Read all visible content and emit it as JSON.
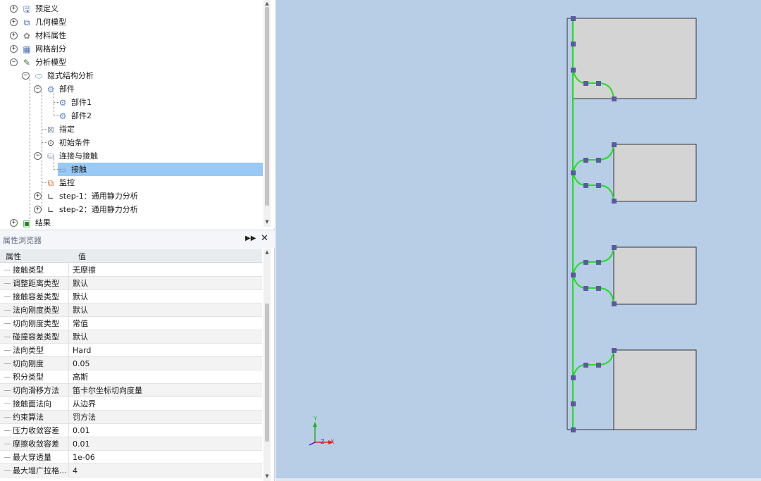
{
  "tree": {
    "items": [
      {
        "label": "预定义",
        "expander": "+",
        "icon": "predefine-icon"
      },
      {
        "label": "几何模型",
        "expander": "+",
        "icon": "geometry-icon"
      },
      {
        "label": "材料属性",
        "expander": "+",
        "icon": "material-icon"
      },
      {
        "label": "网格剖分",
        "expander": "+",
        "icon": "mesh-icon"
      },
      {
        "label": "分析模型",
        "expander": "−",
        "icon": "analysis-model-icon"
      },
      {
        "label": "隐式结构分析",
        "expander": "−",
        "icon": "implicit-analysis-icon"
      },
      {
        "label": "部件",
        "expander": "−",
        "icon": "parts-icon"
      },
      {
        "label": "部件1",
        "expander": "",
        "icon": "part-icon"
      },
      {
        "label": "部件2",
        "expander": "",
        "icon": "part-icon"
      },
      {
        "label": "指定",
        "expander": "",
        "icon": "assign-icon"
      },
      {
        "label": "初始条件",
        "expander": "",
        "icon": "initial-condition-icon"
      },
      {
        "label": "连接与接触",
        "expander": "−",
        "icon": "connection-icon"
      },
      {
        "label": "接触",
        "expander": "",
        "icon": "contact-icon"
      },
      {
        "label": "监控",
        "expander": "",
        "icon": "monitor-icon"
      },
      {
        "label": "step-1：通用静力分析",
        "expander": "+",
        "icon": "step-icon"
      },
      {
        "label": "step-2：通用静力分析",
        "expander": "+",
        "icon": "step-icon"
      },
      {
        "label": "结果",
        "expander": "+",
        "icon": "result-icon"
      }
    ]
  },
  "properties": {
    "title": "属性浏览器",
    "col_name": "属性",
    "col_value": "值",
    "rows": [
      {
        "name": "接触类型",
        "value": "无摩擦"
      },
      {
        "name": "调整距离类型",
        "value": "默认"
      },
      {
        "name": "接触容差类型",
        "value": "默认"
      },
      {
        "name": "法向刚度类型",
        "value": "默认"
      },
      {
        "name": "切向刚度类型",
        "value": "常值"
      },
      {
        "name": "碰撞容差类型",
        "value": "默认"
      },
      {
        "name": "法向类型",
        "value": "Hard"
      },
      {
        "name": "切向刚度",
        "value": "0.05"
      },
      {
        "name": "积分类型",
        "value": "高斯"
      },
      {
        "name": "切向滑移方法",
        "value": "笛卡尔坐标切向度量"
      },
      {
        "name": "接触面法向",
        "value": "从边界"
      },
      {
        "name": "约束算法",
        "value": "罚方法"
      },
      {
        "name": "压力收敛容差",
        "value": "0.01"
      },
      {
        "name": "摩擦收敛容差",
        "value": "0.01"
      },
      {
        "name": "最大穿透量",
        "value": "1e-06"
      },
      {
        "name": "最大增广拉格...",
        "value": "4"
      }
    ]
  },
  "axes": {
    "x": "X",
    "y": "Y",
    "z": "Z"
  },
  "colors": {
    "viewport_bg": "#b8cde6",
    "selection": "#99c9f5",
    "contact_line": "#22dd22",
    "node": "#5a5aa0",
    "part_fill": "#d4d4d4"
  }
}
